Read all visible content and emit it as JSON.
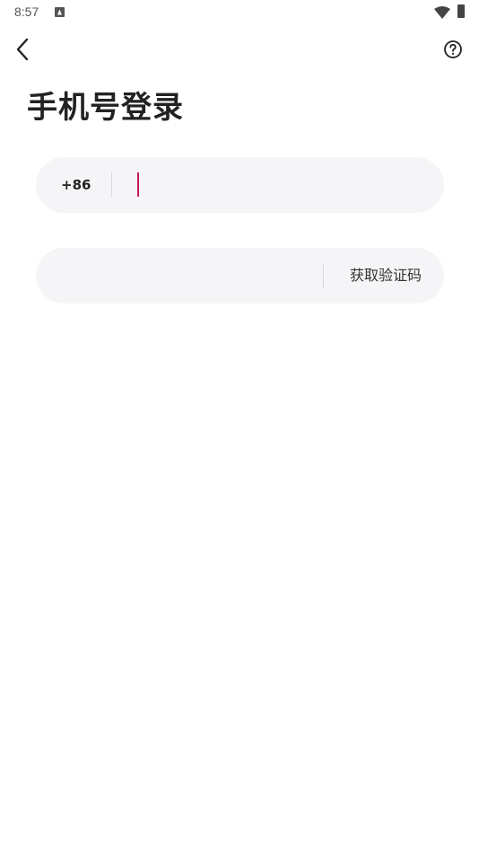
{
  "status_bar": {
    "time": "8:57",
    "notification_icon": "app-notification-icon",
    "wifi_icon": "wifi-icon",
    "battery_icon": "battery-icon"
  },
  "top_bar": {
    "back_icon": "chevron-left-icon",
    "help_icon": "question-circle-icon"
  },
  "title": "手机号登录",
  "phone_form": {
    "country_code": "+86",
    "phone_value": "",
    "phone_placeholder": ""
  },
  "code_form": {
    "code_value": "",
    "code_placeholder": "",
    "get_code_label": "获取验证码"
  },
  "colors": {
    "background": "#ffffff",
    "input_background": "#f5f5f7",
    "cursor_accent": "#c0185a",
    "text_primary": "#222222"
  }
}
